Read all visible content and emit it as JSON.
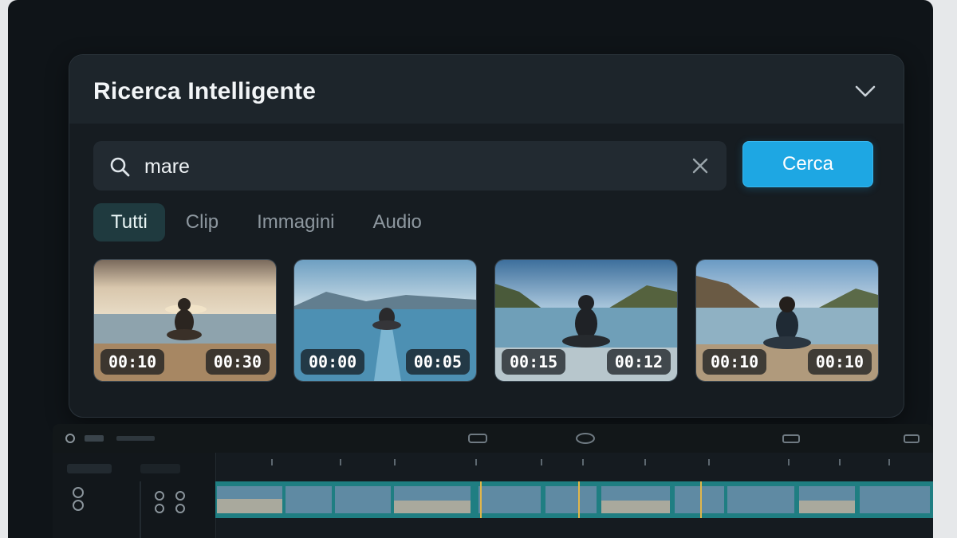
{
  "search_panel": {
    "title": "Ricerca Intelligente",
    "collapse_icon": "chevron-down-icon",
    "search": {
      "icon": "search-icon",
      "value": "mare",
      "placeholder": "",
      "clear_icon": "close-icon"
    },
    "search_button_label": "Cerca",
    "tabs": [
      {
        "label": "Tutti",
        "active": true
      },
      {
        "label": "Clip",
        "active": false
      },
      {
        "label": "Immagini",
        "active": false
      },
      {
        "label": "Audio",
        "active": false
      }
    ],
    "results": [
      {
        "start": "00:10",
        "duration": "00:30"
      },
      {
        "start": "00:00",
        "duration": "00:05"
      },
      {
        "start": "00:15",
        "duration": "00:12"
      },
      {
        "start": "00:10",
        "duration": "00:10"
      }
    ]
  },
  "colors": {
    "accent": "#1ea7e3",
    "active_tab": "#1f3a3f",
    "panel": "#1a2127",
    "track": "#1f7e82"
  }
}
